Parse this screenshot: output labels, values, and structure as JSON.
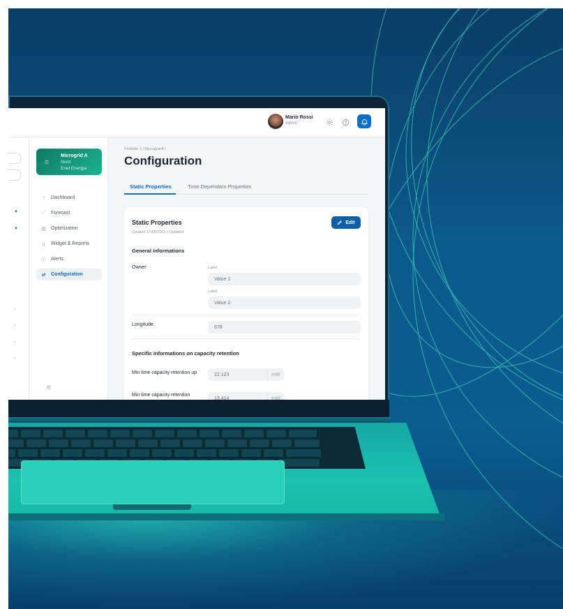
{
  "user": {
    "name": "Mario Rossi",
    "role": "Admin"
  },
  "topbar_icons": [
    "gear-icon",
    "help-circle-icon",
    "bell-icon"
  ],
  "microgrid": {
    "title": "Microgrid A",
    "region": "Nord",
    "company": "Enel Energia"
  },
  "nav": [
    {
      "label": "Dashboard",
      "icon": "gauge-icon"
    },
    {
      "label": "Forecast",
      "icon": "trend-icon"
    },
    {
      "label": "Optimization",
      "icon": "bars-icon"
    },
    {
      "label": "Widget & Reports",
      "icon": "document-icon"
    },
    {
      "label": "Alerts",
      "icon": "alert-icon"
    },
    {
      "label": "Configuration",
      "icon": "sliders-icon"
    }
  ],
  "breadcrumb": "Portfolio 1  /  Microgrid A  /",
  "page_title": "Configuration",
  "tabs": [
    "Static Properties",
    "Time Dependant Properties"
  ],
  "card": {
    "title": "Static Properties",
    "created": "Created 17/05/2022  •  Updated",
    "edit_label": "Edit",
    "general_title": "General informations",
    "owner_label": "Owner",
    "owner_values": [
      {
        "sublabel": "Label",
        "value": "Value 1"
      },
      {
        "sublabel": "Label",
        "value": "Value 2"
      }
    ],
    "longitude_label": "Longitude",
    "longitude_value": "678",
    "capacity_title": "Specific informations on capacity retention",
    "capacity_rows": [
      {
        "label": "Min time capacity retention up",
        "value": "22.123",
        "unit": "mW"
      },
      {
        "label": "Min time capacity retention",
        "value": "13.414",
        "unit": "mW"
      }
    ]
  },
  "collapse_glyph": "«",
  "colors": {
    "accent": "#0d6ec9",
    "card_gradient_start": "#0e7a64",
    "card_gradient_end": "#1bb38f",
    "background": "#0b5c8f"
  }
}
